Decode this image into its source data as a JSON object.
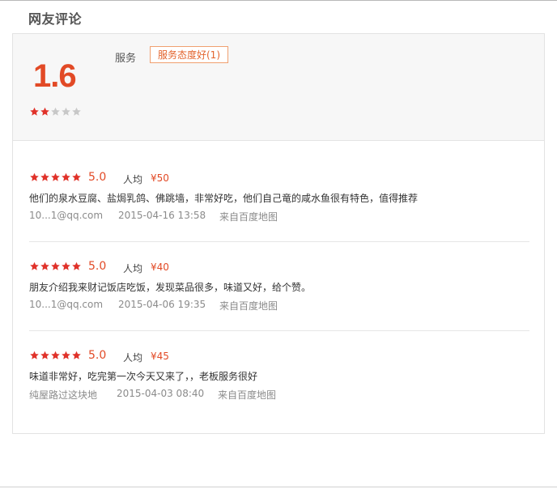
{
  "section_title": "网友评论",
  "summary": {
    "score": "1.6",
    "rating": 2,
    "max_rating": 5,
    "service_label": "服务",
    "service_tag": "服务态度好(1)"
  },
  "reviews": [
    {
      "rating": 5,
      "score": "5.0",
      "avg_label": "人均",
      "avg_price": "¥50",
      "text": "他们的泉水豆腐、盐焗乳鸽、佛跳墙，非常好吃，他们自己竜的咸水鱼很有特色，值得推荐",
      "user": "10...1@qq.com",
      "time": "2015-04-16 13:58",
      "source": "来自百度地图"
    },
    {
      "rating": 5,
      "score": "5.0",
      "avg_label": "人均",
      "avg_price": "¥40",
      "text": "朋友介绍我来财记饭店吃饭，发现菜品很多，味道又好，给个赞。",
      "user": "10...1@qq.com",
      "time": "2015-04-06 19:35",
      "source": "来自百度地图"
    },
    {
      "rating": 5,
      "score": "5.0",
      "avg_label": "人均",
      "avg_price": "¥45",
      "text": "味道非常好，吃完第一次今天又来了，，老板服务很好",
      "user": "纯屋路过这块地",
      "time": "2015-04-03 08:40",
      "source": "来自百度地图"
    }
  ],
  "colors": {
    "accent": "#e24a26",
    "star_filled": "#e0322a",
    "star_empty": "#c8c8c8",
    "tag_border": "#f0a070",
    "tag_text": "#e3632c",
    "muted": "#8b8b8b"
  }
}
